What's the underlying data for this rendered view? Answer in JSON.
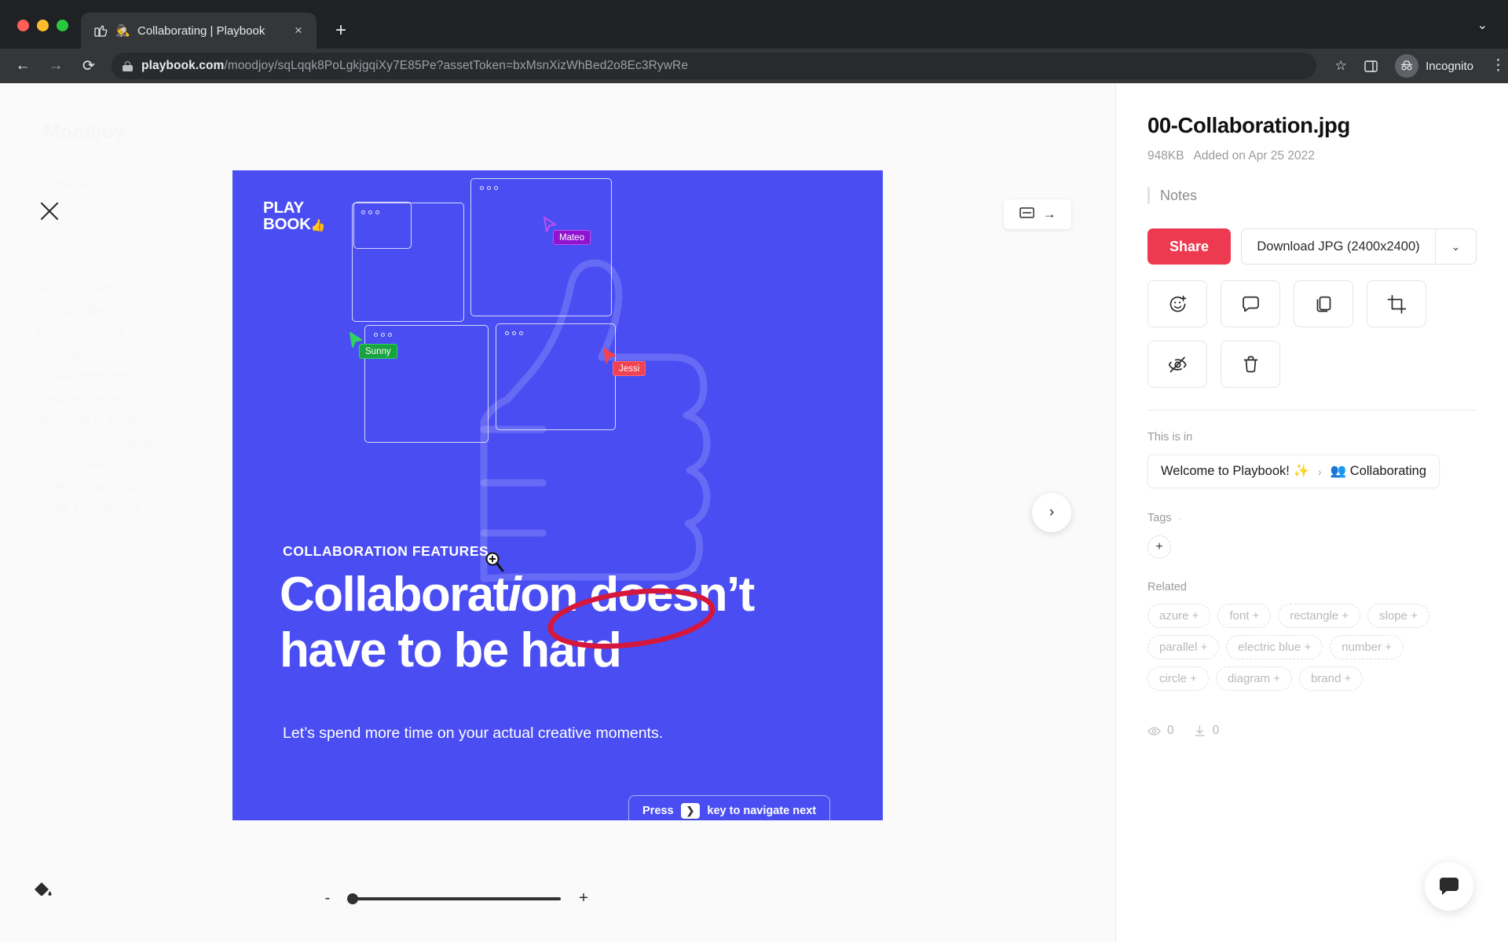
{
  "browser": {
    "tab": {
      "title": "Collaborating | Playbook",
      "favicon": "playbook-thumb-icon",
      "close_label": "×"
    },
    "new_tab_label": "+",
    "tab_list_caret": "⌄",
    "url": {
      "host": "playbook.com",
      "path": "/moodjoy/sqLqqk8PoLgkjgqiXy7E85Pe?assetToken=bxMsnXizWhBed2o8Ec3RywRe"
    },
    "back_label": "←",
    "forward_label": "→",
    "reload_label": "⟳",
    "bookmark_label": "☆",
    "sidepanel_label": "▥",
    "profile": {
      "name": "Incognito"
    },
    "menu_label": "⋮"
  },
  "background_app": {
    "workspace": "Moodjoy",
    "nav": [
      {
        "label": "All media",
        "sub": false
      },
      {
        "label": "People",
        "sub": false
      },
      {
        "label": "Sarah Jones",
        "sub": false
      }
    ],
    "section_label": "Boards",
    "boards": [
      {
        "label": "More uploads",
        "sub": false
      },
      {
        "label": "Main files",
        "sub": true
      },
      {
        "label": "My design stuff",
        "sub": false
      },
      {
        "label": "Logos",
        "sub": true
      },
      {
        "label": "Random things",
        "sub": true
      },
      {
        "label": "Website designs",
        "sub": false
      },
      {
        "label": "Welcome to Playbook!",
        "sub": false
      },
      {
        "label": "👋 Getting started",
        "sub": true
      },
      {
        "label": "🔗 Sharing",
        "sub": true
      },
      {
        "label": "👥 Collaborating",
        "sub": true
      },
      {
        "label": "🎨 Playground",
        "sub": true
      }
    ],
    "footer_item": "Public workspace"
  },
  "viewer": {
    "close_label": "close-icon",
    "fit_button": {
      "layout_icon": "fit-layout-icon",
      "arrow_label": "→"
    },
    "next_label": "›",
    "zoom": {
      "minus": "-",
      "plus": "+",
      "value": 0
    }
  },
  "slide": {
    "brand": {
      "line1": "PLAY",
      "line2": "BOOK",
      "mark": "👍"
    },
    "eyebrow": "COLLABORATION FEATURES",
    "headline_part1": "Collaborat",
    "headline_italic": "i",
    "headline_part2": "on ",
    "headline_circled": "doesn’t",
    "headline_line2": "have to be hard",
    "subline": "Let’s spend more time on your actual creative moments.",
    "press_key": {
      "prefix": "Press",
      "key": "❯",
      "suffix": "key to navigate next"
    },
    "cursors": [
      {
        "name": "Mateo",
        "color": "#9013cf",
        "border": "#c44bf0"
      },
      {
        "name": "Sunny",
        "color": "#18a33e",
        "border": "#2fd45f"
      },
      {
        "name": "Jessi",
        "color": "#ef4352",
        "border": "#ff6673"
      }
    ],
    "colors": {
      "background": "#4a4ef2",
      "circle": "#d6173c"
    }
  },
  "inspector": {
    "filename": "00-Collaboration.jpg",
    "filesize": "948KB",
    "added": "Added on Apr 25 2022",
    "notes_label": "Notes",
    "share_label": "Share",
    "download_label": "Download JPG (2400x2400)",
    "download_caret": "⌄",
    "tools": [
      {
        "name": "add-reaction-icon"
      },
      {
        "name": "comment-icon"
      },
      {
        "name": "duplicate-icon"
      },
      {
        "name": "crop-icon"
      },
      {
        "name": "hide-icon"
      },
      {
        "name": "delete-icon"
      }
    ],
    "location_label": "This is in",
    "breadcrumb": {
      "parent": "Welcome to Playbook! ✨",
      "separator": "›",
      "current": "👥 Collaborating"
    },
    "tags_label": "Tags",
    "tags_hint": "·",
    "tag_add_label": "+",
    "related_label": "Related",
    "related": [
      "azure +",
      "font +",
      "rectangle +",
      "slope +",
      "parallel +",
      "electric blue +",
      "number +",
      "circle +",
      "diagram +",
      "brand +"
    ],
    "views": "0",
    "downloads": "0",
    "accent_red": "#ee3a50"
  },
  "chat": {
    "icon": "chat-bubble-icon"
  }
}
